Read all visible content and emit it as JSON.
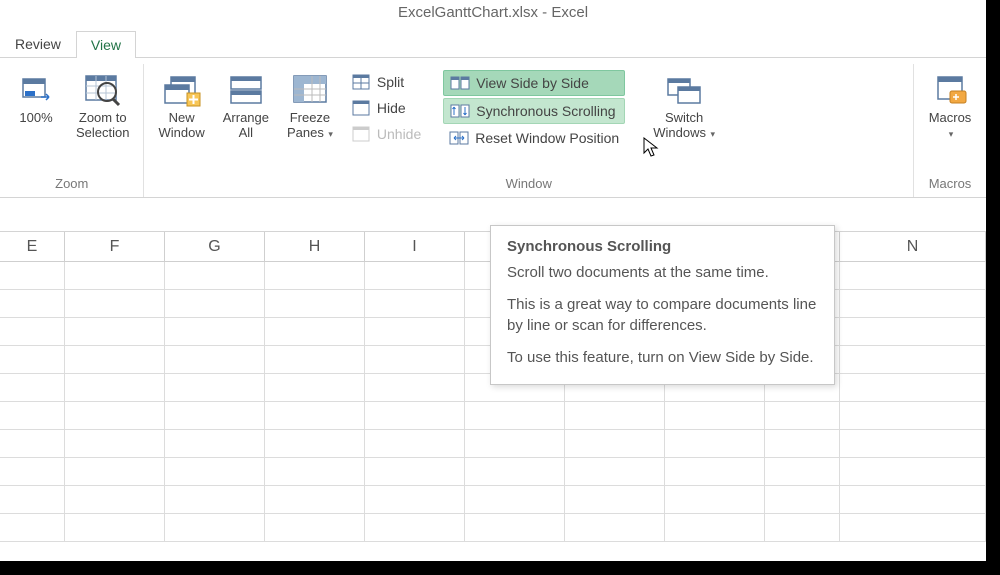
{
  "title": "ExcelGanttChart.xlsx - Excel",
  "tabs": {
    "review": "Review",
    "view": "View"
  },
  "zoom": {
    "zoom100": "100%",
    "zoomSel": "Zoom to\nSelection",
    "label": "Zoom"
  },
  "window": {
    "newWindow": "New\nWindow",
    "arrangeAll": "Arrange\nAll",
    "freezePanes": "Freeze\nPanes",
    "split": "Split",
    "hide": "Hide",
    "unhide": "Unhide",
    "viewSideBySide": "View Side by Side",
    "syncScrolling": "Synchronous Scrolling",
    "resetWindowPos": "Reset Window Position",
    "switchWindows": "Switch\nWindows",
    "label": "Window"
  },
  "macros": {
    "macros": "Macros",
    "label": "Macros"
  },
  "columns": [
    "E",
    "F",
    "G",
    "H",
    "I",
    "",
    "",
    "",
    "",
    "N"
  ],
  "tooltip": {
    "title": "Synchronous Scrolling",
    "p1": "Scroll two documents at the same time.",
    "p2": "This is a great way to compare documents line by line or scan for differences.",
    "p3": "To use this feature, turn on View Side by Side."
  }
}
